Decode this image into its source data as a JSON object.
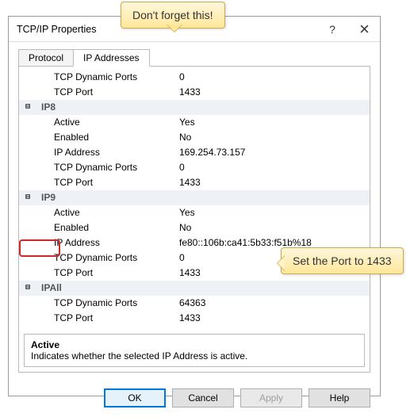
{
  "window": {
    "title": "TCP/IP Properties"
  },
  "tabs": {
    "protocol": "Protocol",
    "ip": "IP Addresses"
  },
  "rows": [
    {
      "type": "child",
      "label": "TCP Dynamic Ports",
      "value": "0"
    },
    {
      "type": "child",
      "label": "TCP Port",
      "value": "1433"
    },
    {
      "type": "group",
      "label": "IP8",
      "value": ""
    },
    {
      "type": "child",
      "label": "Active",
      "value": "Yes"
    },
    {
      "type": "child",
      "label": "Enabled",
      "value": "No"
    },
    {
      "type": "child",
      "label": "IP Address",
      "value": "169.254.73.157"
    },
    {
      "type": "child",
      "label": "TCP Dynamic Ports",
      "value": "0"
    },
    {
      "type": "child",
      "label": "TCP Port",
      "value": "1433"
    },
    {
      "type": "group",
      "label": "IP9",
      "value": ""
    },
    {
      "type": "child",
      "label": "Active",
      "value": "Yes"
    },
    {
      "type": "child",
      "label": "Enabled",
      "value": "No"
    },
    {
      "type": "child",
      "label": "IP Address",
      "value": "fe80::106b:ca41:5b33:f51b%18"
    },
    {
      "type": "child",
      "label": "TCP Dynamic Ports",
      "value": "0"
    },
    {
      "type": "child",
      "label": "TCP Port",
      "value": "1433"
    },
    {
      "type": "group",
      "label": "IPAll",
      "value": ""
    },
    {
      "type": "child",
      "label": "TCP Dynamic Ports",
      "value": "64363"
    },
    {
      "type": "child",
      "label": "TCP Port",
      "value": "1433"
    }
  ],
  "description": {
    "title": "Active",
    "text": "Indicates whether the selected IP Address is active."
  },
  "buttons": {
    "ok": "OK",
    "cancel": "Cancel",
    "apply": "Apply",
    "help": "Help"
  },
  "callouts": {
    "top": "Don't forget this!",
    "right": "Set the Port to 1433"
  }
}
